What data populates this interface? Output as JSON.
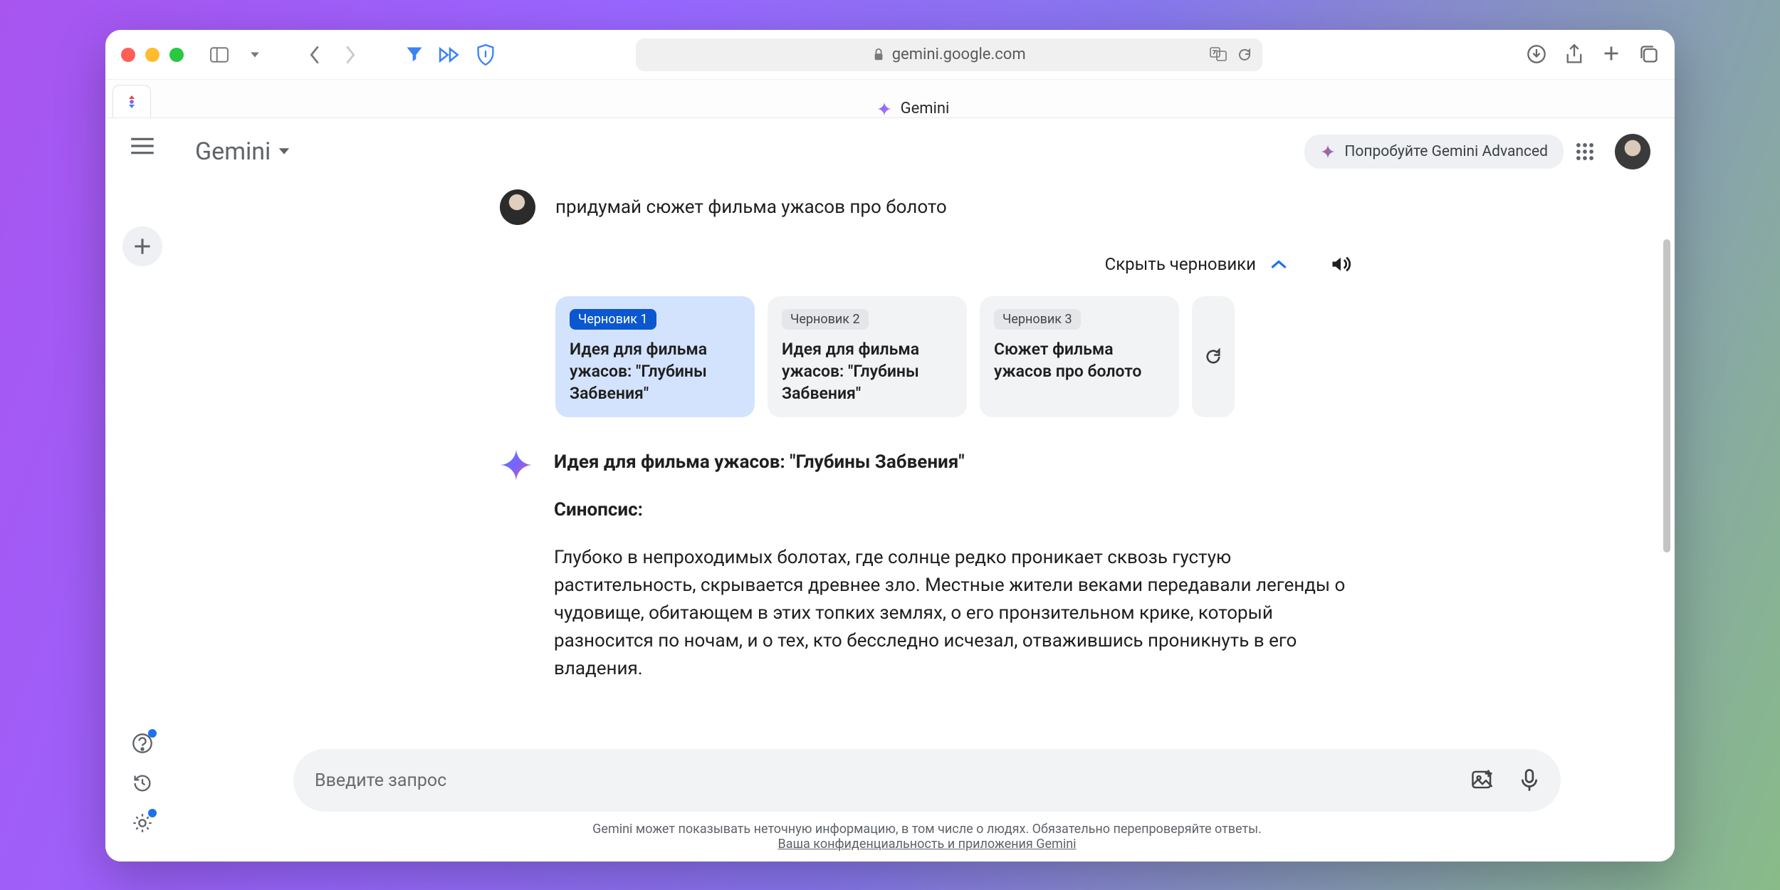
{
  "browser": {
    "url": "gemini.google.com",
    "tab_label": "Gemini"
  },
  "header": {
    "brand": "Gemini",
    "advanced_label": "Попробуйте Gemini Advanced"
  },
  "user_prompt": "придумай сюжет фильма ужасов про болото",
  "draft_toggle": "Скрыть черновики",
  "drafts": [
    {
      "chip": "Черновик 1",
      "title": "Идея для фильма ужасов: \"Глубины Забвения\"",
      "selected": true
    },
    {
      "chip": "Черновик 2",
      "title": "Идея для фильма ужасов: \"Глубины Забвения\"",
      "selected": false
    },
    {
      "chip": "Черновик 3",
      "title": "Сюжет фильма ужасов про болото",
      "selected": false
    }
  ],
  "answer": {
    "title": "Идея для фильма ужасов: \"Глубины Забвения\"",
    "sub": "Синопсис:",
    "body": "Глубоко в непроходимых болотах, где солнце редко проникает сквозь густую растительность, скрывается древнее зло. Местные жители веками передавали легенды о чудовище, обитающем в этих топких землях, о его пронзительном крике, который разносится по ночам, и о тех, кто бесследно исчезал, отважившись проникнуть в его владения."
  },
  "prompt_placeholder": "Введите запрос",
  "footer": {
    "line": "Gemini может показывать неточную информацию, в том числе о людях. Обязательно перепроверяйте ответы.",
    "link": "Ваша конфиденциальность и приложения Gemini"
  }
}
